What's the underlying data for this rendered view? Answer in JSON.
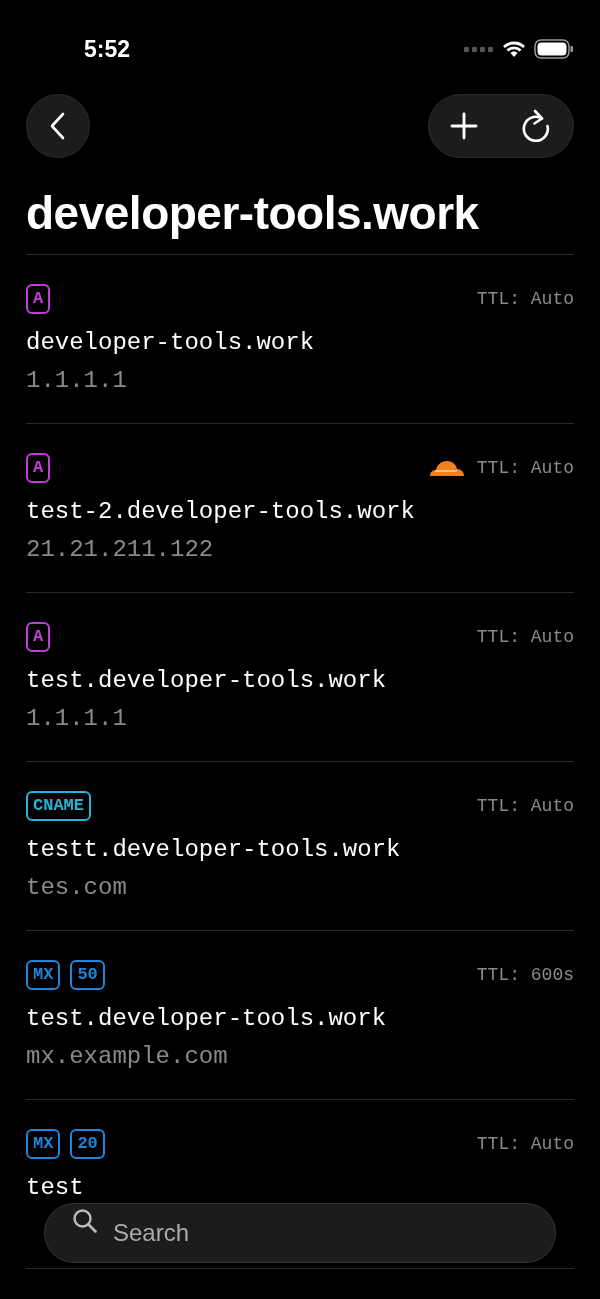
{
  "status_bar": {
    "time": "5:52"
  },
  "title": "developer-tools.work",
  "records": [
    {
      "badges": [
        {
          "text": "A",
          "color": "#c13fd6"
        }
      ],
      "proxied": false,
      "ttl": "TTL: Auto",
      "name": "developer-tools.work",
      "value": "1.1.1.1"
    },
    {
      "badges": [
        {
          "text": "A",
          "color": "#c13fd6"
        }
      ],
      "proxied": true,
      "ttl": "TTL: Auto",
      "name": "test-2.developer-tools.work",
      "value": "21.21.211.122"
    },
    {
      "badges": [
        {
          "text": "A",
          "color": "#c13fd6"
        }
      ],
      "proxied": false,
      "ttl": "TTL: Auto",
      "name": "test.developer-tools.work",
      "value": "1.1.1.1"
    },
    {
      "badges": [
        {
          "text": "CNAME",
          "color": "#27b4d6"
        }
      ],
      "proxied": false,
      "ttl": "TTL: Auto",
      "name": "testt.developer-tools.work",
      "value": "tes.com"
    },
    {
      "badges": [
        {
          "text": "MX",
          "color": "#1f86d9"
        },
        {
          "text": "50",
          "color": "#1f86d9"
        }
      ],
      "proxied": false,
      "ttl": "TTL: 600s",
      "name": "test.developer-tools.work",
      "value": "mx.example.com"
    },
    {
      "badges": [
        {
          "text": "MX",
          "color": "#1f86d9"
        },
        {
          "text": "20",
          "color": "#1f86d9"
        }
      ],
      "proxied": false,
      "ttl": "TTL: Auto",
      "name": "test"
    }
  ],
  "search": {
    "placeholder": "Search"
  }
}
